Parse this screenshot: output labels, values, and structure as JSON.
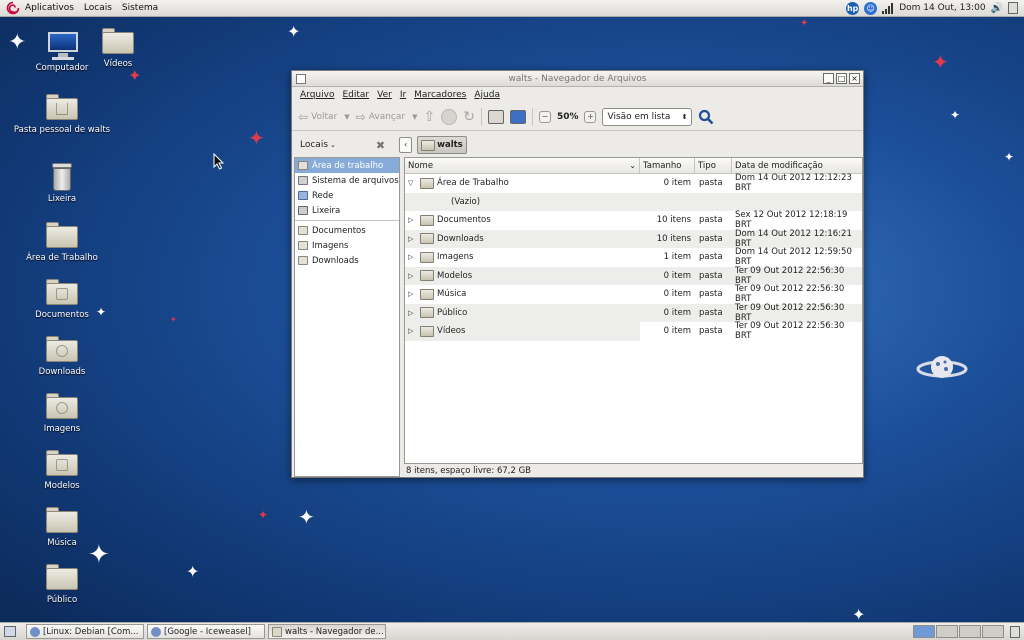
{
  "top_panel": {
    "menus": [
      "Aplicativos",
      "Locais",
      "Sistema"
    ],
    "clock": "Dom 14 Out, 13:00"
  },
  "desktop": {
    "icons": [
      {
        "label": "Computador"
      },
      {
        "label": "Vídeos"
      },
      {
        "label": "Pasta pessoal de walts"
      },
      {
        "label": "Lixeira"
      },
      {
        "label": "Área de Trabalho"
      },
      {
        "label": "Documentos"
      },
      {
        "label": "Downloads"
      },
      {
        "label": "Imagens"
      },
      {
        "label": "Modelos"
      },
      {
        "label": "Música"
      },
      {
        "label": "Público"
      }
    ]
  },
  "window": {
    "title": "walts - Navegador de Arquivos",
    "menu": [
      "Arquivo",
      "Editar",
      "Ver",
      "Ir",
      "Marcadores",
      "Ajuda"
    ],
    "toolbar": {
      "back": "Voltar",
      "forward": "Avançar",
      "zoom": "50%",
      "view_mode": "Visão em lista"
    },
    "location": {
      "places_label": "Locais",
      "path_button": "walts"
    },
    "sidebar": {
      "items": [
        "Área de trabalho",
        "Sistema de arquivos",
        "Rede",
        "Lixeira",
        "Documentos",
        "Imagens",
        "Downloads"
      ]
    },
    "columns": {
      "name": "Nome",
      "size": "Tamanho",
      "type": "Tipo",
      "date": "Data de modificação"
    },
    "rows": [
      {
        "expander": "▽",
        "name": "Área de Trabalho",
        "size": "0 item",
        "type": "pasta",
        "date": "Dom 14 Out 2012 12:12:23 BRT"
      },
      {
        "expander": "",
        "name": "(Vazio)",
        "size": "",
        "type": "",
        "date": ""
      },
      {
        "expander": "▷",
        "name": "Documentos",
        "size": "10 itens",
        "type": "pasta",
        "date": "Sex 12 Out 2012 12:18:19 BRT"
      },
      {
        "expander": "▷",
        "name": "Downloads",
        "size": "10 itens",
        "type": "pasta",
        "date": "Dom 14 Out 2012 12:16:21 BRT"
      },
      {
        "expander": "▷",
        "name": "Imagens",
        "size": "1 item",
        "type": "pasta",
        "date": "Dom 14 Out 2012 12:59:50 BRT"
      },
      {
        "expander": "▷",
        "name": "Modelos",
        "size": "0 item",
        "type": "pasta",
        "date": "Ter 09 Out 2012 22:56:30 BRT"
      },
      {
        "expander": "▷",
        "name": "Música",
        "size": "0 item",
        "type": "pasta",
        "date": "Ter 09 Out 2012 22:56:30 BRT"
      },
      {
        "expander": "▷",
        "name": "Público",
        "size": "0 item",
        "type": "pasta",
        "date": "Ter 09 Out 2012 22:56:30 BRT"
      },
      {
        "expander": "▷",
        "name": "Vídeos",
        "size": "0 item",
        "type": "pasta",
        "date": "Ter 09 Out 2012 22:56:30 BRT"
      }
    ],
    "status": "8 itens, espaço livre: 67,2 GB"
  },
  "taskbar": {
    "tasks": [
      "[Linux: Debian [Com...",
      "[Google - Iceweasel]",
      "walts - Navegador de..."
    ]
  }
}
